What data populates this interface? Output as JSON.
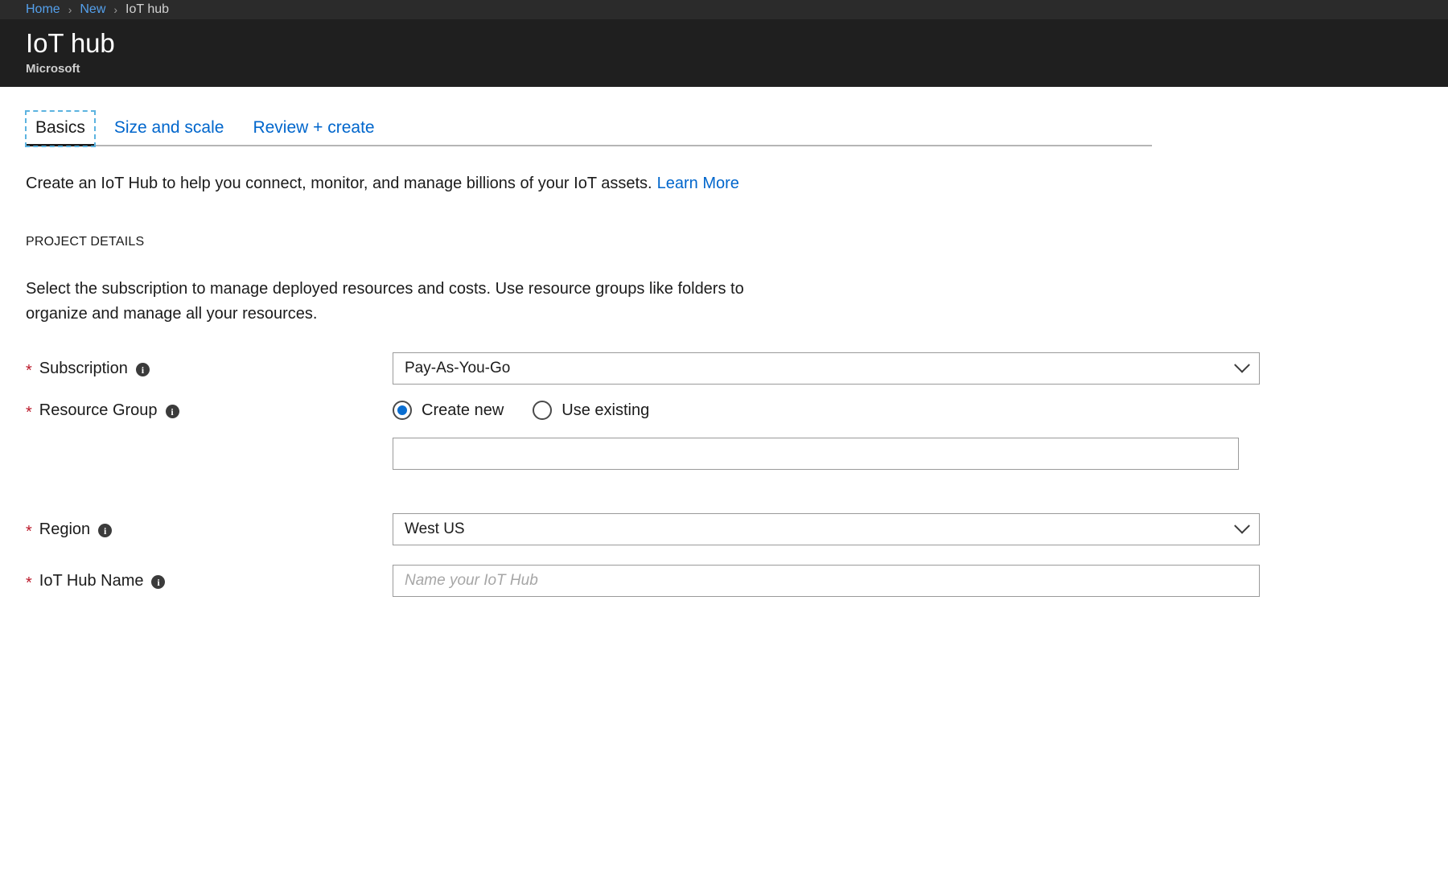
{
  "breadcrumb": {
    "items": [
      {
        "label": "Home",
        "link": true
      },
      {
        "label": "New",
        "link": true
      },
      {
        "label": "IoT hub",
        "link": false
      }
    ],
    "separator": "›"
  },
  "header": {
    "title": "IoT hub",
    "subtitle": "Microsoft"
  },
  "tabs": [
    {
      "label": "Basics",
      "active": true
    },
    {
      "label": "Size and scale",
      "active": false
    },
    {
      "label": "Review + create",
      "active": false
    }
  ],
  "intro": {
    "text": "Create an IoT Hub to help you connect, monitor, and manage billions of your IoT assets.",
    "link_label": "Learn More"
  },
  "section": {
    "heading": "PROJECT DETAILS",
    "description": "Select the subscription to manage deployed resources and costs. Use resource groups like folders to organize and manage all your resources."
  },
  "form": {
    "required_marker": "*",
    "info_glyph": "i",
    "chevron_icon": "chevron-down-icon",
    "subscription": {
      "label": "Subscription",
      "value": "Pay-As-You-Go"
    },
    "resource_group": {
      "label": "Resource Group",
      "options": [
        {
          "label": "Create new",
          "selected": true
        },
        {
          "label": "Use existing",
          "selected": false
        }
      ],
      "value": "",
      "placeholder": ""
    },
    "region": {
      "label": "Region",
      "value": "West US"
    },
    "iot_hub_name": {
      "label": "IoT Hub Name",
      "value": "",
      "placeholder": "Name your IoT Hub"
    }
  },
  "colors": {
    "breadcrumb_bg": "#2b2b2b",
    "title_bg": "#1f1f1f",
    "link_blue": "#0066cc",
    "crumb_blue": "#54a0ec",
    "required_red": "#bb1a2b",
    "radio_blue": "#0a6ed1",
    "focus_dash": "#5cb3e0"
  }
}
